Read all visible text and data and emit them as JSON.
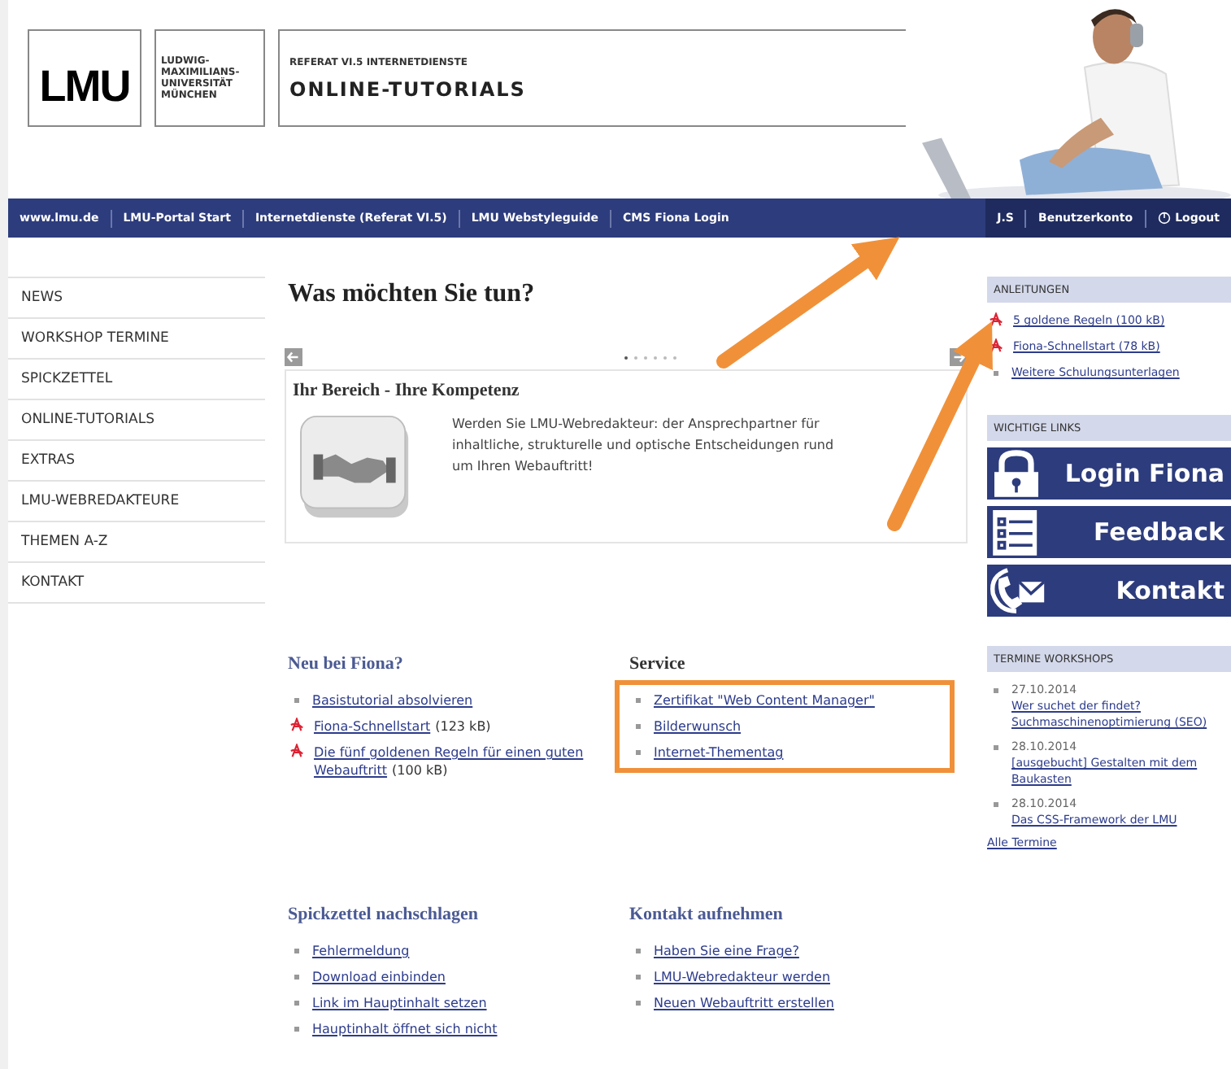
{
  "header": {
    "logo": "LMU",
    "university_lines": [
      "LUDWIG-",
      "MAXIMILIANS-",
      "UNIVERSITÄT",
      "MÜNCHEN"
    ],
    "subtitle": "REFERAT VI.5 INTERNETDIENSTE",
    "title": "ONLINE-TUTORIALS"
  },
  "nav": {
    "left": [
      "www.lmu.de",
      "LMU-Portal Start",
      "Internetdienste (Referat VI.5)",
      "LMU Webstyleguide",
      "CMS Fiona Login"
    ],
    "right": [
      {
        "label": "J.S",
        "kind": "text"
      },
      {
        "label": "Benutzerkonto",
        "kind": "text"
      },
      {
        "label": "Logout",
        "kind": "logout"
      }
    ]
  },
  "sidebar": {
    "items": [
      "NEWS",
      "WORKSHOP TERMINE",
      "SPICKZETTEL",
      "ONLINE-TUTORIALS",
      "EXTRAS",
      "LMU-WEBREDAKTEURE",
      "THEMEN A-Z",
      "KONTAKT"
    ]
  },
  "main": {
    "heading": "Was möchten Sie tun?",
    "slider": {
      "dots": [
        {
          "selected": true
        },
        {
          "selected": false
        },
        {
          "selected": false
        },
        {
          "selected": false
        },
        {
          "selected": false
        },
        {
          "selected": false
        }
      ],
      "slide_title": "Ihr Bereich - Ihre Kompetenz",
      "slide_text": "Werden Sie LMU-Webredakteur: der Ansprechpartner für inhaltliche, strukturelle und optische Entscheidungen rund um Ihren Webauftritt!"
    },
    "sections": [
      {
        "title": "Neu bei Fiona?",
        "highlighted": false,
        "items": [
          {
            "kind": "link",
            "text": "Basistutorial absolvieren"
          },
          {
            "kind": "pdf",
            "text": "Fiona-Schnellstart",
            "suffix": "(123 kB)"
          },
          {
            "kind": "pdf",
            "text": "Die fünf goldenen Regeln für einen guten Webauftritt",
            "suffix": "(100 kB)"
          }
        ]
      },
      {
        "title": "Service",
        "highlighted": true,
        "items": [
          {
            "kind": "link",
            "text": "Zertifikat \"Web Content Manager\""
          },
          {
            "kind": "link",
            "text": "Bilderwunsch"
          },
          {
            "kind": "link",
            "text": "Internet-Thementag"
          }
        ]
      },
      {
        "title": "Spickzettel nachschlagen",
        "highlighted": false,
        "items": [
          {
            "kind": "link",
            "text": "Fehlermeldung"
          },
          {
            "kind": "link",
            "text": "Download einbinden"
          },
          {
            "kind": "link",
            "text": "Link im Hauptinhalt setzen"
          },
          {
            "kind": "link",
            "text": "Hauptinhalt öffnet sich nicht"
          }
        ]
      },
      {
        "title": "Kontakt aufnehmen",
        "highlighted": false,
        "items": [
          {
            "kind": "link",
            "text": "Haben Sie eine Frage?"
          },
          {
            "kind": "link",
            "text": "LMU-Webredakteur werden"
          },
          {
            "kind": "link",
            "text": "Neuen Webauftritt erstellen"
          }
        ]
      }
    ]
  },
  "right": {
    "guides": {
      "title": "ANLEITUNGEN",
      "items": [
        {
          "kind": "pdf",
          "text": "5 goldene Regeln (100 kB)"
        },
        {
          "kind": "pdf",
          "text": "Fiona-Schnellstart (78 kB)"
        },
        {
          "kind": "link",
          "text": "Weitere Schulungsunterlagen"
        }
      ]
    },
    "links": {
      "title": "WICHTIGE LINKS",
      "banners": [
        {
          "kind": "lock",
          "label": "Login Fiona"
        },
        {
          "kind": "list",
          "label": "Feedback"
        },
        {
          "kind": "phone",
          "label": "Kontakt"
        }
      ]
    },
    "workshops": {
      "title": "TERMINE WORKSHOPS",
      "entries": [
        {
          "date": "27.10.2014",
          "title": "Wer suchet der findet? Suchmaschinenoptimierung (SEO)"
        },
        {
          "date": "28.10.2014",
          "title": "[ausgebucht] Gestalten mit dem Baukasten"
        },
        {
          "date": "28.10.2014",
          "title": "Das CSS-Framework der LMU"
        }
      ],
      "all": "Alle Termine"
    }
  }
}
